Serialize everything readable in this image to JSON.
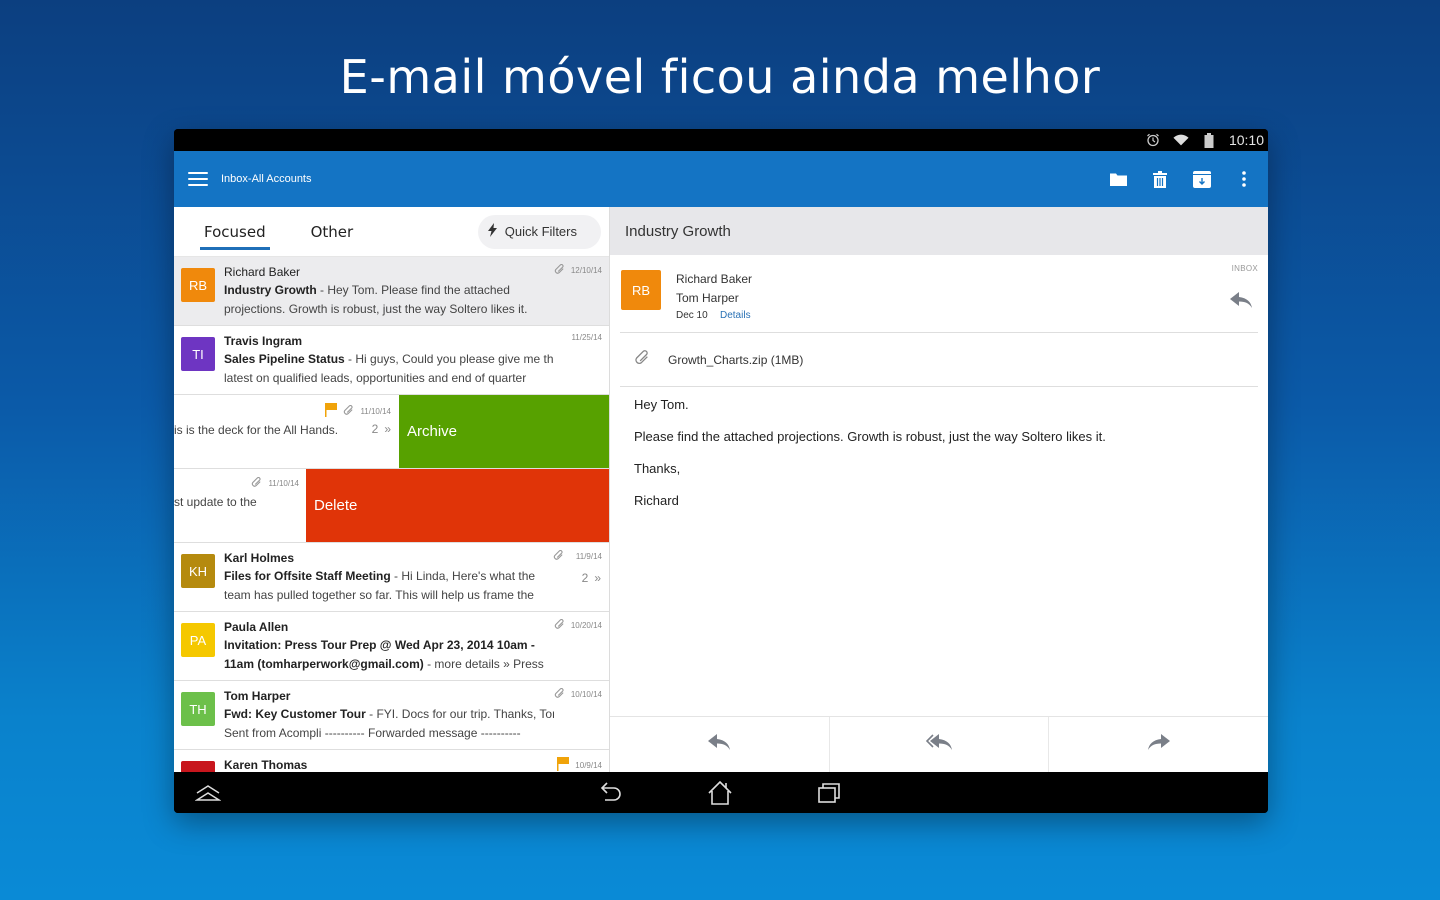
{
  "headline": "E-mail móvel ficou ainda melhor",
  "colors": {
    "appbar": "#1474c4",
    "archive": "#57a100",
    "delete": "#e03408",
    "flag": "#f0a30a",
    "link": "#2a72b5"
  },
  "statusbar": {
    "time": "10:10",
    "icons": [
      "alarm-icon",
      "wifi-icon",
      "battery-icon"
    ]
  },
  "appbar": {
    "title": "Inbox-All Accounts",
    "actions": [
      "move-folder-icon",
      "delete-icon",
      "archive-icon",
      "more-options-icon"
    ]
  },
  "tabs": {
    "focused": "Focused",
    "other": "Other",
    "quick_filters": "Quick Filters"
  },
  "messages": [
    {
      "initials": "RB",
      "color": "#f0890c",
      "sender": "Richard Baker",
      "unread": false,
      "subject": "Industry Growth",
      "preview1": " - Hey Tom. Please find the attached",
      "preview2": "projections. Growth is robust, just the way Soltero likes it.",
      "date": "12/10/14",
      "attachment": true,
      "flag": false,
      "selected": true
    },
    {
      "initials": "TI",
      "color": "#6e35c2",
      "sender": "Travis Ingram",
      "unread": true,
      "subject": "Sales Pipeline Status",
      "preview1": " - Hi guys, Could you please give me the",
      "preview2": "latest on qualified leads, opportunities and end of quarter",
      "date": "11/25/14",
      "attachment": false,
      "flag": false
    },
    {
      "swipe_action": "Archive",
      "preview": "is is the deck for the All Hands.",
      "date": "11/10/14",
      "attachment": true,
      "flag": true,
      "count": "2"
    },
    {
      "swipe_action": "Delete",
      "preview": "st update to the",
      "date": "11/10/14",
      "attachment": true,
      "flag": false
    },
    {
      "initials": "KH",
      "color": "#b58a0e",
      "sender": "Karl Holmes",
      "unread": true,
      "subject": "Files for Offsite Staff Meeting",
      "preview1": " - Hi Linda, Here's what the",
      "preview2": "team has pulled together so far. This will help us frame the",
      "date": "11/9/14",
      "attachment": true,
      "flag": false,
      "count": "2"
    },
    {
      "initials": "PA",
      "color": "#f5c800",
      "sender": "Paula Allen",
      "unread": true,
      "subject": "Invitation: Press Tour Prep @ Wed Apr 23, 2014 10am -",
      "subject2": "11am (tomharperwork@gmail.com)",
      "preview2": " - more details » Press",
      "date": "10/20/14",
      "attachment": true,
      "flag": false
    },
    {
      "initials": "TH",
      "color": "#6cc04a",
      "sender": "Tom Harper",
      "unread": true,
      "subject": "Fwd: Key Customer Tour",
      "preview1": " - FYI. Docs for our trip. Thanks, Tom",
      "preview2": "Sent from Acompli ---------- Forwarded message ----------",
      "date": "10/10/14",
      "attachment": true,
      "flag": false
    },
    {
      "initials": "",
      "color": "#c8161d",
      "sender": "Karen Thomas",
      "unread": true,
      "subject": "",
      "preview1": "",
      "preview2": "",
      "date": "10/9/14",
      "attachment": false,
      "flag": true
    }
  ],
  "reader": {
    "subject": "Industry Growth",
    "initials": "RB",
    "from": "Richard Baker",
    "to": "Tom Harper",
    "date": "Dec 10",
    "details_link": "Details",
    "folder": "INBOX",
    "attachment": "Growth_Charts.zip (1MB)",
    "body": [
      "Hey Tom.",
      "Please find the attached projections. Growth is robust, just the way Soltero likes it.",
      "Thanks,",
      "Richard"
    ],
    "actions": [
      "reply-icon",
      "reply-all-icon",
      "forward-icon"
    ]
  },
  "navbar": [
    "collapse-icon",
    "back-icon",
    "home-icon",
    "recent-apps-icon"
  ]
}
